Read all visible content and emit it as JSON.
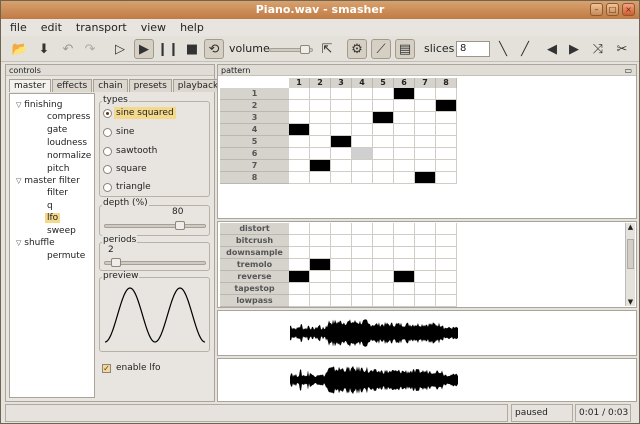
{
  "window": {
    "title": "Piano.wav - smasher"
  },
  "menu": [
    "file",
    "edit",
    "transport",
    "view",
    "help"
  ],
  "toolbar": {
    "volume_label": "volume",
    "slices_label": "slices",
    "slices_value": "8"
  },
  "controls": {
    "title": "controls",
    "tabs": [
      "master",
      "effects",
      "chain",
      "presets",
      "playback"
    ],
    "tree": [
      {
        "label": "finishing",
        "level": 0,
        "expanded": true
      },
      {
        "label": "compress",
        "level": 1
      },
      {
        "label": "gate",
        "level": 1
      },
      {
        "label": "loudness",
        "level": 1
      },
      {
        "label": "normalize",
        "level": 1
      },
      {
        "label": "pitch",
        "level": 1
      },
      {
        "label": "master filter",
        "level": 0,
        "expanded": true
      },
      {
        "label": "filter",
        "level": 1
      },
      {
        "label": "q",
        "level": 1
      },
      {
        "label": "lfo",
        "level": 1,
        "selected": true
      },
      {
        "label": "sweep",
        "level": 1
      },
      {
        "label": "shuffle",
        "level": 0,
        "expanded": true
      },
      {
        "label": "permute",
        "level": 1
      }
    ],
    "types_label": "types",
    "types": [
      "sine squared",
      "sine",
      "sawtooth",
      "square",
      "triangle"
    ],
    "selected_type": "sine squared",
    "depth_label": "depth (%)",
    "depth_value": "80",
    "periods_label": "periods",
    "periods_value": "2",
    "preview_label": "preview",
    "enable_label": "enable lfo",
    "enable_checked": true
  },
  "pattern": {
    "title": "pattern",
    "columns": [
      "1",
      "2",
      "3",
      "4",
      "5",
      "6",
      "7",
      "8"
    ],
    "rows": [
      "1",
      "2",
      "3",
      "4",
      "5",
      "6",
      "7",
      "8"
    ],
    "filled": [
      [
        1,
        6
      ],
      [
        2,
        8
      ],
      [
        3,
        5
      ],
      [
        4,
        1
      ],
      [
        5,
        3
      ],
      [
        6,
        4
      ],
      [
        7,
        2
      ],
      [
        8,
        7
      ]
    ],
    "grey": [
      [
        6,
        4
      ]
    ]
  },
  "effects": {
    "rows": [
      "distort",
      "bitcrush",
      "downsample",
      "tremolo",
      "reverse",
      "tapestop",
      "lowpass"
    ],
    "filled": [
      [
        3,
        2
      ],
      [
        4,
        1
      ],
      [
        4,
        6
      ]
    ]
  },
  "status": {
    "state": "paused",
    "time": "0:01 / 0:03"
  }
}
